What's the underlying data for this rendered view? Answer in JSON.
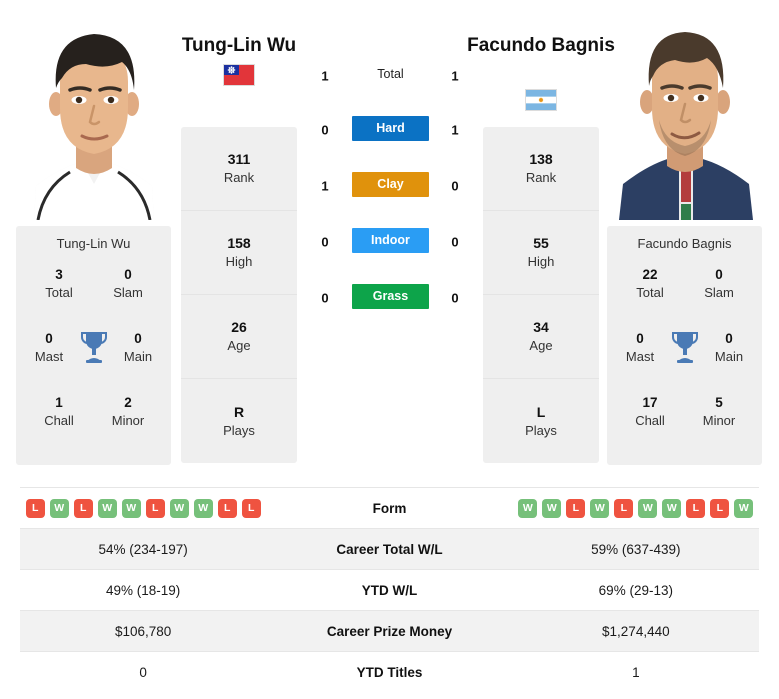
{
  "players": {
    "left": {
      "name": "Tung-Lin Wu",
      "flag": "taiwan-flag",
      "rank": "311",
      "rank_label": "Rank",
      "high": "158",
      "high_label": "High",
      "age": "26",
      "age_label": "Age",
      "plays": "R",
      "plays_label": "Plays",
      "titles_name": "Tung-Lin Wu",
      "titles": {
        "total": "3",
        "total_label": "Total",
        "slam": "0",
        "slam_label": "Slam",
        "mast": "0",
        "mast_label": "Mast",
        "main": "0",
        "main_label": "Main",
        "chall": "1",
        "chall_label": "Chall",
        "minor": "2",
        "minor_label": "Minor"
      },
      "form": [
        "L",
        "W",
        "L",
        "W",
        "W",
        "L",
        "W",
        "W",
        "L",
        "L"
      ],
      "career_total_wl": "54% (234-197)",
      "ytd_wl": "49% (18-19)",
      "career_prize_money": "$106,780",
      "ytd_titles": "0"
    },
    "right": {
      "name": "Facundo Bagnis",
      "flag": "argentina-flag",
      "rank": "138",
      "rank_label": "Rank",
      "high": "55",
      "high_label": "High",
      "age": "34",
      "age_label": "Age",
      "plays": "L",
      "plays_label": "Plays",
      "titles_name": "Facundo Bagnis",
      "titles": {
        "total": "22",
        "total_label": "Total",
        "slam": "0",
        "slam_label": "Slam",
        "mast": "0",
        "mast_label": "Mast",
        "main": "0",
        "main_label": "Main",
        "chall": "17",
        "chall_label": "Chall",
        "minor": "5",
        "minor_label": "Minor"
      },
      "form": [
        "W",
        "W",
        "L",
        "W",
        "L",
        "W",
        "W",
        "L",
        "L",
        "W"
      ],
      "career_total_wl": "59% (637-439)",
      "ytd_wl": "69% (29-13)",
      "career_prize_money": "$1,274,440",
      "ytd_titles": "1"
    }
  },
  "h2h": {
    "rows": [
      {
        "label": "Total",
        "left": "1",
        "right": "1",
        "color": ""
      },
      {
        "label": "Hard",
        "left": "0",
        "right": "1",
        "color": "#0b72c4"
      },
      {
        "label": "Clay",
        "left": "1",
        "right": "0",
        "color": "#e0920c"
      },
      {
        "label": "Indoor",
        "left": "0",
        "right": "0",
        "color": "#2a9df4"
      },
      {
        "label": "Grass",
        "left": "0",
        "right": "0",
        "color": "#0da44a"
      }
    ]
  },
  "table": {
    "form_label": "Form",
    "rows": [
      {
        "label": "Career Total W/L",
        "left": "54% (234-197)",
        "right": "59% (637-439)"
      },
      {
        "label": "YTD W/L",
        "left": "49% (18-19)",
        "right": "69% (29-13)"
      },
      {
        "label": "Career Prize Money",
        "left": "$106,780",
        "right": "$1,274,440"
      },
      {
        "label": "YTD Titles",
        "left": "0",
        "right": "1"
      }
    ]
  },
  "colors": {
    "hard": "#0b72c4",
    "clay": "#e0920c",
    "indoor": "#2a9df4",
    "grass": "#0da44a",
    "win": "#76c07a",
    "loss": "#ef5340",
    "trophy": "#4a7ab5",
    "card_bg": "#efefef"
  }
}
